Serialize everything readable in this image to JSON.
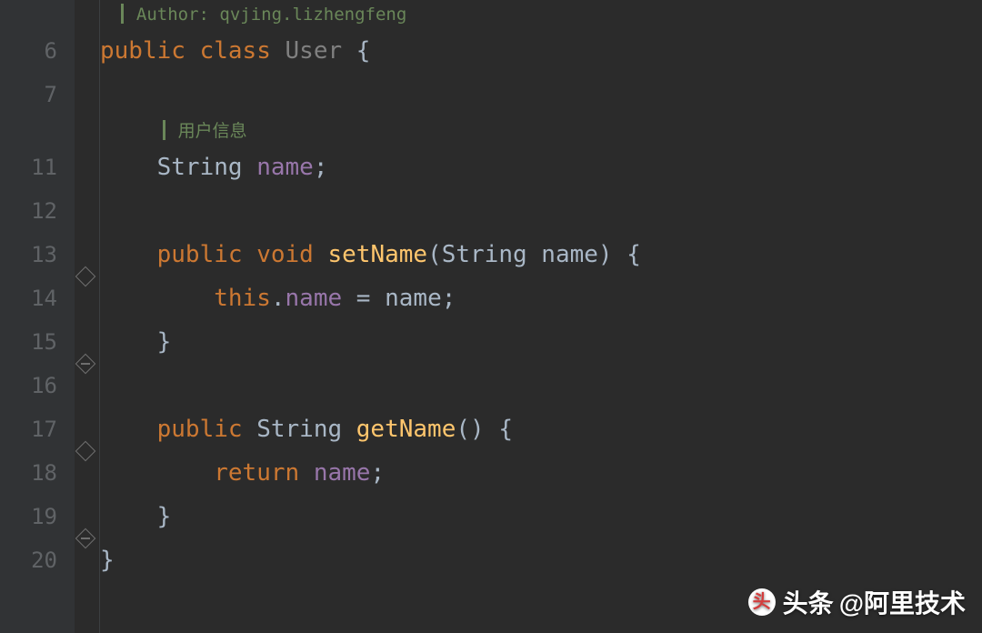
{
  "lineNumbers": [
    "",
    "6",
    "7",
    "",
    "11",
    "12",
    "13",
    "14",
    "15",
    "16",
    "17",
    "18",
    "19",
    "20"
  ],
  "doc1": "Author: qvjing.lizhengfeng",
  "doc2": "用户信息",
  "tokens": {
    "public": "public",
    "class": "class",
    "void": "void",
    "return": "return",
    "this": "this",
    "String": "String",
    "User": "User",
    "name": "name",
    "setName": "setName",
    "getName": "getName",
    "lbrace": "{",
    "rbrace": "}",
    "lparen": "(",
    "rparen": ")",
    "semi": ";",
    "dot": ".",
    "eq": " = ",
    "sp": " "
  },
  "indent": {
    "i0": "",
    "i1": "    ",
    "i2": "        "
  },
  "watermark": {
    "brand": "头条",
    "handle": "@阿里技术"
  }
}
